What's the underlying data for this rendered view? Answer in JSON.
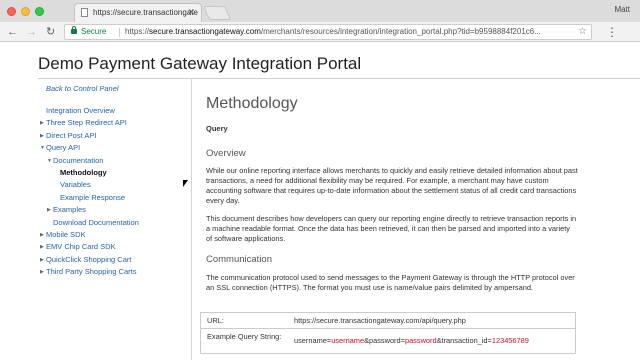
{
  "browser": {
    "tab_title": "https://secure.transactiongate",
    "user_name": "Matt",
    "secure_label": "Secure",
    "url_scheme": "https://",
    "url_host": "secure.transactiongateway.com",
    "url_path": "/merchants/resources/integration/integration_portal.php?tid=b9598884f201c6..."
  },
  "page": {
    "title": "Demo Payment Gateway Integration Portal"
  },
  "sidebar": {
    "back_link": "Back to Control Panel",
    "items": [
      {
        "label": "Integration Overview",
        "indent": 0,
        "toggle": ""
      },
      {
        "label": "Three Step Redirect API",
        "indent": 0,
        "toggle": "collapsed"
      },
      {
        "label": "Direct Post API",
        "indent": 0,
        "toggle": "collapsed"
      },
      {
        "label": "Query API",
        "indent": 0,
        "toggle": "expanded"
      },
      {
        "label": "Documentation",
        "indent": 1,
        "toggle": "expanded"
      },
      {
        "label": "Methodology",
        "indent": 2,
        "toggle": "",
        "active": true
      },
      {
        "label": "Variables",
        "indent": 2,
        "toggle": ""
      },
      {
        "label": "Example Response",
        "indent": 2,
        "toggle": ""
      },
      {
        "label": "Examples",
        "indent": 1,
        "toggle": "collapsed"
      },
      {
        "label": "Download Documentation",
        "indent": 1,
        "toggle": ""
      },
      {
        "label": "Mobile SDK",
        "indent": 0,
        "toggle": "collapsed"
      },
      {
        "label": "EMV Chip Card SDK",
        "indent": 0,
        "toggle": "collapsed"
      },
      {
        "label": "QuickClick Shopping Cart",
        "indent": 0,
        "toggle": "collapsed"
      },
      {
        "label": "Third Party Shopping Carts",
        "indent": 0,
        "toggle": "collapsed"
      }
    ]
  },
  "main": {
    "heading": "Methodology",
    "subheading": "Query",
    "overview_heading": "Overview",
    "overview_p1": "While our online reporting interface allows merchants to quickly and easily retrieve detailed information about past transactions, a need for additional flexibility may be required. For example, a merchant may have custom accounting software that requires up-to-date information about the settlement status of all credit card transactions every day.",
    "overview_p2": "This document describes how developers can query our reporting engine directly to retrieve transaction reports in a machine readable format. Once the data has been retrieved, it can then be parsed and imported into a variety of software applications.",
    "communication_heading": "Communication",
    "communication_p": "The communication protocol used to send messages to the Payment Gateway is through the HTTP protocol over an SSL connection (HTTPS). The format you must use is name/value pairs delimited by ampersand.",
    "table": {
      "url_label": "URL:",
      "url_value": "https://secure.transactiongateway.com/api/query.php",
      "example_label": "Example Query String:",
      "example_parts": {
        "p1": "username=",
        "v1": "username",
        "p2": "&password=",
        "v2": "password",
        "p3": "&transaction_id=",
        "v3": "123456789"
      }
    }
  },
  "colors": {
    "link": "#2864a8",
    "secure_green": "#0b8043",
    "highlight_red": "#c8102e"
  }
}
